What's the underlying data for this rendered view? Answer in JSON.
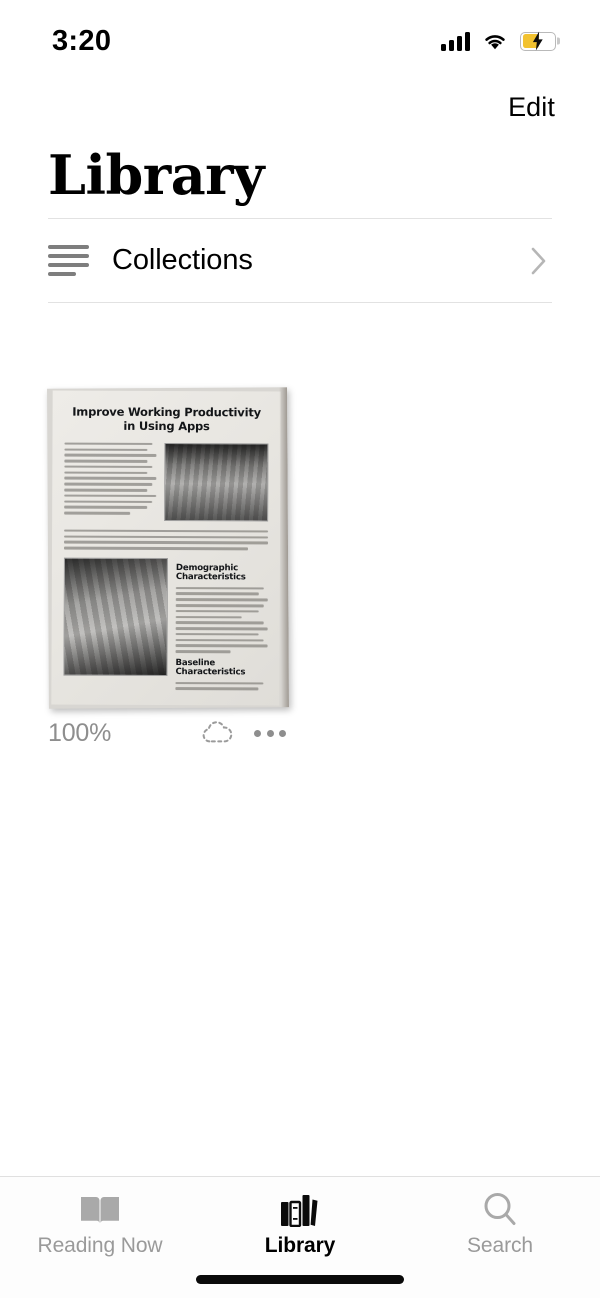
{
  "status_bar": {
    "time": "3:20",
    "cellular_icon": "signal-bars-icon",
    "wifi_icon": "wifi-icon",
    "battery_icon": "battery-charging-icon",
    "battery_color": "#f2c230",
    "battery_level_percent": 52
  },
  "nav": {
    "edit_label": "Edit"
  },
  "header": {
    "title": "Library"
  },
  "collections": {
    "label": "Collections",
    "icon": "collections-list-icon",
    "chevron": "chevron-right-icon"
  },
  "library": {
    "books": [
      {
        "progress": "100%",
        "cloud_icon": "icloud-dashed-icon",
        "more_icon": "more-ellipsis-icon",
        "cover": {
          "title": "Improve Working Productivity in Using Apps",
          "title_line_1": "Improve Working Productivity",
          "title_line_2": "in Using Apps",
          "section_1": "Demographic Characteristics",
          "section_2": "Baseline Characteristics",
          "photo_1": "conference-room-photo",
          "photo_2": "office-workers-photo",
          "background_color": "#e6e4df"
        }
      }
    ]
  },
  "tab_bar": {
    "tabs": [
      {
        "label": "Reading Now",
        "icon": "open-book-icon",
        "active": false
      },
      {
        "label": "Library",
        "icon": "books-shelf-icon",
        "active": true
      },
      {
        "label": "Search",
        "icon": "search-magnifier-icon",
        "active": false
      }
    ]
  },
  "colors": {
    "active_tab": "#000000",
    "inactive_tab": "#9a9a9a",
    "divider": "#e2e2e2",
    "secondary_text": "#8e8e8e",
    "background": "#ffffff"
  }
}
